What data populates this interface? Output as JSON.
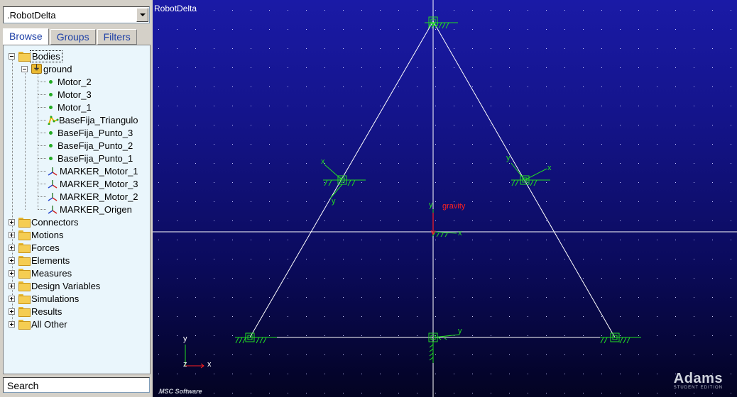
{
  "browser": {
    "model_name": ".RobotDelta",
    "tabs": [
      {
        "label": "Browse",
        "active": true
      },
      {
        "label": "Groups",
        "active": false
      },
      {
        "label": "Filters",
        "active": false
      }
    ],
    "tree": {
      "bodies_label": "Bodies",
      "ground_label": "ground",
      "ground_children": [
        {
          "label": "Motor_2",
          "icon": "point-icon"
        },
        {
          "label": "Motor_3",
          "icon": "point-icon"
        },
        {
          "label": "Motor_1",
          "icon": "point-icon"
        },
        {
          "label": "BaseFija_Triangulo",
          "icon": "polyline-icon"
        },
        {
          "label": "BaseFija_Punto_3",
          "icon": "point-icon"
        },
        {
          "label": "BaseFija_Punto_2",
          "icon": "point-icon"
        },
        {
          "label": "BaseFija_Punto_1",
          "icon": "point-icon"
        },
        {
          "label": "MARKER_Motor_1",
          "icon": "marker-icon"
        },
        {
          "label": "MARKER_Motor_3",
          "icon": "marker-icon"
        },
        {
          "label": "MARKER_Motor_2",
          "icon": "marker-icon"
        },
        {
          "label": "MARKER_Origen",
          "icon": "marker-icon"
        }
      ],
      "categories": [
        "Connectors",
        "Motions",
        "Forces",
        "Elements",
        "Measures",
        "Design Variables",
        "Simulations",
        "Results",
        "All Other"
      ]
    },
    "search_placeholder": "Search"
  },
  "viewport": {
    "title": "RobotDelta",
    "gravity_label": "gravity",
    "triad": {
      "x": "x",
      "y": "y",
      "z": "z"
    },
    "brand": "Adams",
    "brand_sub": "STUDENT EDITION",
    "vendor": "MSC Software",
    "colors": {
      "background_top": "#1a1aa6",
      "background_bottom": "#030322",
      "geometry": "#ffffff",
      "markers": "#22dd22",
      "gravity": "#ff2020"
    }
  }
}
